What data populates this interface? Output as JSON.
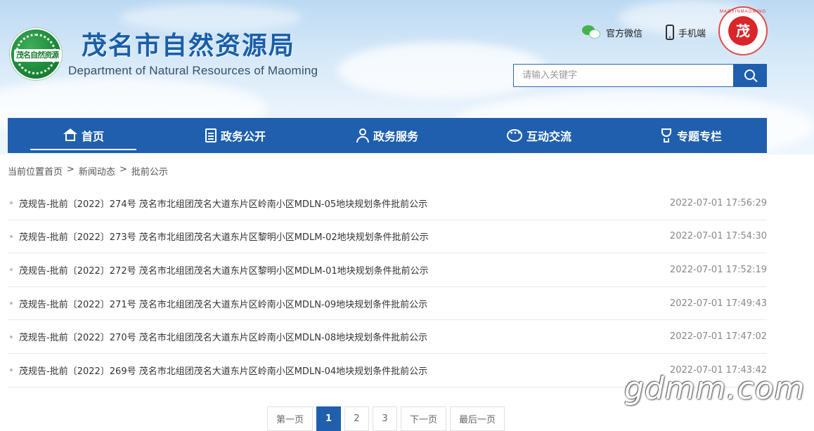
{
  "header": {
    "logo_text": "茂名自然资源",
    "site_title": "茂名市自然资源局",
    "site_subtitle": "Department of Natural Resources of Maoming",
    "wechat_label": "官方微信",
    "mobile_label": "手机端",
    "emblem_ring_text": "MAOXINMAOMING",
    "emblem_center": "茂",
    "search_placeholder": "请输入关键字",
    "icons": [
      "wechat-icon",
      "phone-icon",
      "search-icon"
    ]
  },
  "nav": {
    "items": [
      {
        "label": "首页",
        "icon": "home-icon",
        "active": true
      },
      {
        "label": "政务公开",
        "icon": "document-icon"
      },
      {
        "label": "政务服务",
        "icon": "user-service-icon"
      },
      {
        "label": "互动交流",
        "icon": "chat-icon"
      },
      {
        "label": "专题专栏",
        "icon": "trophy-icon"
      }
    ]
  },
  "breadcrumb": {
    "items": [
      "当前位置首页",
      "新闻动态",
      "批前公示"
    ],
    "separator": ">"
  },
  "list": {
    "items": [
      {
        "title": "茂规告-批前〔2022〕274号 茂名市北组团茂名大道东片区岭南小区MDLN-05地块规划条件批前公示",
        "date": "2022-07-01 17:56:29"
      },
      {
        "title": "茂规告-批前〔2022〕273号 茂名市北组团茂名大道东片区黎明小区MDLM-02地块规划条件批前公示",
        "date": "2022-07-01 17:54:30"
      },
      {
        "title": "茂规告-批前〔2022〕272号 茂名市北组团茂名大道东片区黎明小区MDLM-01地块规划条件批前公示",
        "date": "2022-07-01 17:52:19"
      },
      {
        "title": "茂规告-批前〔2022〕271号 茂名市北组团茂名大道东片区岭南小区MDLN-09地块规划条件批前公示",
        "date": "2022-07-01 17:49:43"
      },
      {
        "title": "茂规告-批前〔2022〕270号 茂名市北组团茂名大道东片区岭南小区MDLN-08地块规划条件批前公示",
        "date": "2022-07-01 17:47:02"
      },
      {
        "title": "茂规告-批前〔2022〕269号 茂名市北组团茂名大道东片区岭南小区MDLN-04地块规划条件批前公示",
        "date": "2022-07-01 17:43:42"
      }
    ]
  },
  "pagination": {
    "first": "第一页",
    "pages": [
      "1",
      "2",
      "3"
    ],
    "current": "1",
    "next": "下一页",
    "last": "最后一页"
  },
  "watermark": "gdmm.com",
  "colors": {
    "primary": "#1f5fad",
    "title": "#1a5ea8",
    "logo_green": "#1e8a3c"
  }
}
